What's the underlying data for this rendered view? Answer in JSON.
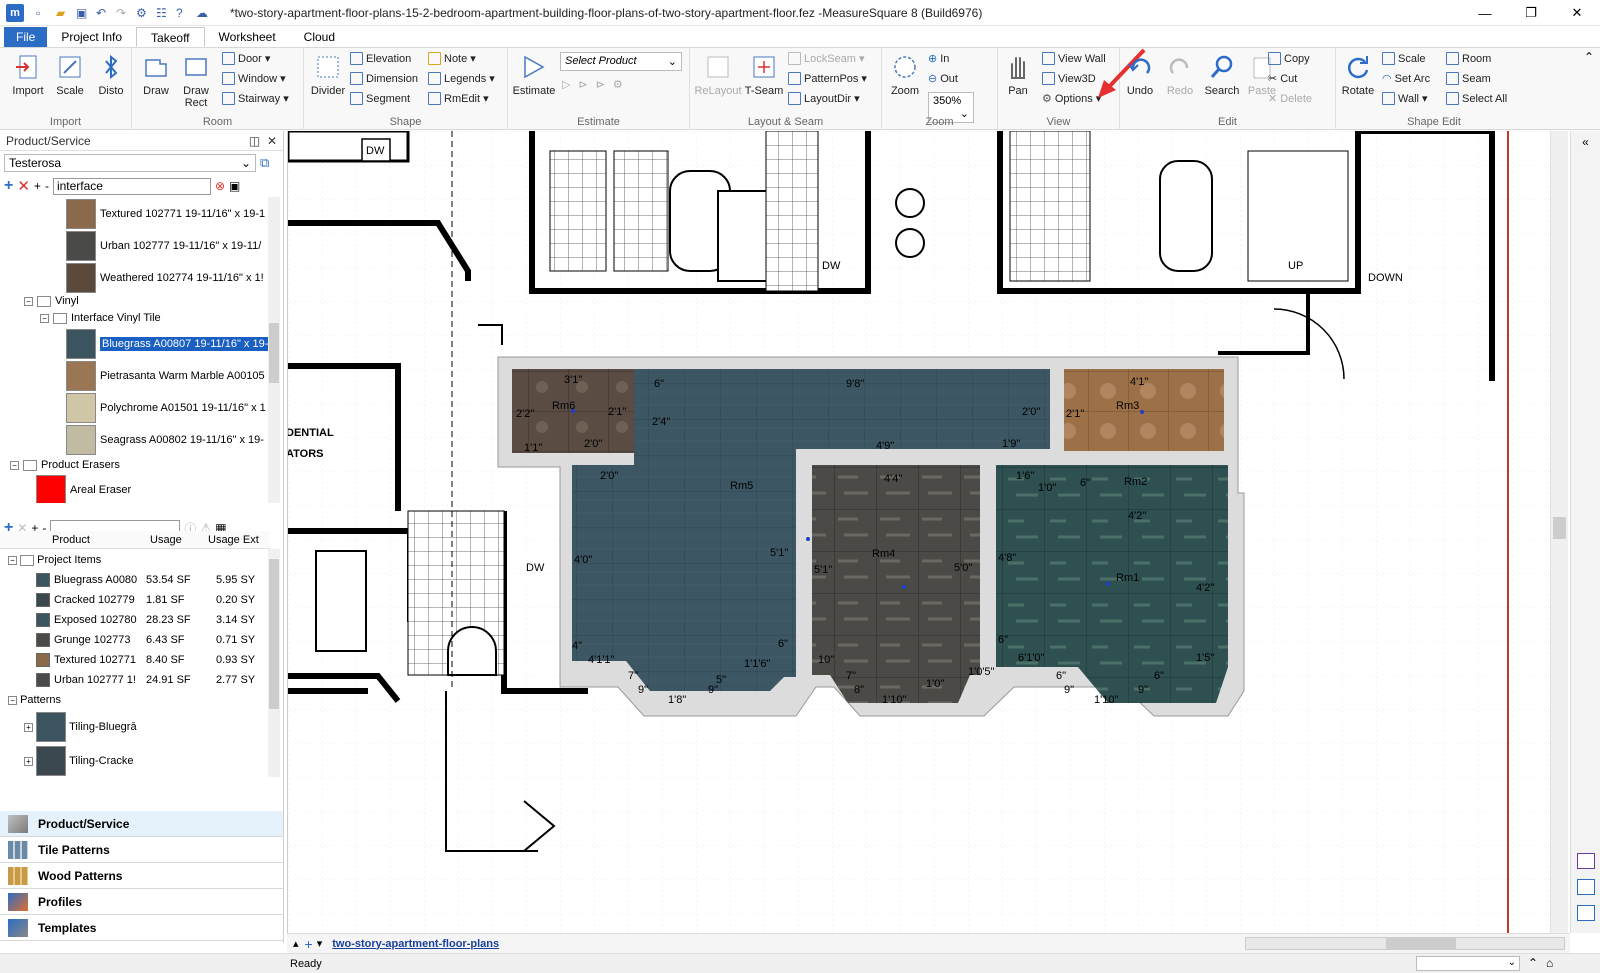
{
  "window": {
    "title": "*two-story-apartment-floor-plans-15-2-bedroom-apartment-building-floor-plans-of-two-story-apartment-floor.fez -MeasureSquare 8 (Build6976)",
    "app_icon": "m"
  },
  "tabs": [
    {
      "label": "File"
    },
    {
      "label": "Project Info"
    },
    {
      "label": "Takeoff"
    },
    {
      "label": "Worksheet"
    },
    {
      "label": "Cloud"
    }
  ],
  "ribbon": {
    "import": {
      "label": "Import",
      "items": [
        "Import",
        "Scale",
        "Disto"
      ]
    },
    "room": {
      "label": "Room",
      "draw": "Draw",
      "draw_rect": "Draw Rect",
      "door": "Door",
      "window": "Window",
      "stairway": "Stairway"
    },
    "shape": {
      "label": "Shape",
      "divider": "Divider",
      "elevation": "Elevation",
      "dimension": "Dimension",
      "segment": "Segment",
      "note": "Note",
      "legends": "Legends",
      "rmedit": "RmEdit"
    },
    "estimate": {
      "label": "Estimate",
      "estimate": "Estimate",
      "select_product": "Select Product"
    },
    "layout": {
      "label": "Layout & Seam",
      "relayout": "ReLayout",
      "tseam": "T-Seam",
      "lockseam": "LockSeam",
      "patternpos": "PatternPos",
      "layoutdir": "LayoutDir"
    },
    "zoom": {
      "label": "Zoom",
      "zoom": "Zoom",
      "in": "In",
      "out": "Out",
      "level": "350%"
    },
    "view": {
      "label": "View",
      "pan": "Pan",
      "view_wall": "View Wall",
      "view3d": "View3D",
      "options": "Options"
    },
    "edit": {
      "label": "Edit",
      "undo": "Undo",
      "redo": "Redo",
      "search": "Search",
      "paste": "Paste",
      "copy": "Copy",
      "cut": "Cut",
      "delete": "Delete"
    },
    "shape_edit": {
      "label": "Shape Edit",
      "rotate": "Rotate",
      "scale": "Scale",
      "set_arc": "Set Arc",
      "wall": "Wall",
      "room": "Room",
      "seam": "Seam",
      "select_all": "Select All"
    }
  },
  "left_panel": {
    "header": "Product/Service",
    "vendor": "Testerosa",
    "search_value": "interface",
    "tree": [
      {
        "label": "Textured 102771 19-11/16\" x 19-1",
        "color": "#8a6a4a"
      },
      {
        "label": "Urban 102777 19-11/16\" x 19-11/",
        "color": "#4a4a48"
      },
      {
        "label": "Weathered 102774 19-11/16\" x 1!",
        "color": "#5b4a3c"
      },
      {
        "label": "Vinyl"
      },
      {
        "label": "Interface Vinyl Tile"
      },
      {
        "label": "Bluegrass A00807 19-11/16\" x 19-",
        "color": "#3c5460"
      },
      {
        "label": "Pietrasanta Warm Marble A00105",
        "color": "#9a7654"
      },
      {
        "label": "Polychrome A01501 19-11/16\" x 1",
        "color": "#cfc6a8"
      },
      {
        "label": "Seagrass A00802 19-11/16\" x 19-",
        "color": "#c2bba4"
      },
      {
        "label": "Product Erasers"
      },
      {
        "label": "Areal Eraser",
        "color": "#ff0000"
      }
    ],
    "usage_headers": [
      "Product",
      "Usage",
      "Usage Ext"
    ],
    "project_items_label": "Project Items",
    "usage_rows": [
      {
        "name": "Bluegrass A0080",
        "usage": "53.54 SF",
        "ext": "5.95 SY",
        "color": "#3c5460"
      },
      {
        "name": "Cracked 102779",
        "usage": "1.81 SF",
        "ext": "0.20 SY",
        "color": "#3c4850"
      },
      {
        "name": "Exposed 102780",
        "usage": "28.23 SF",
        "ext": "3.14 SY",
        "color": "#3a5560"
      },
      {
        "name": "Grunge 102773",
        "usage": "6.43 SF",
        "ext": "0.71 SY",
        "color": "#4c4a46"
      },
      {
        "name": "Textured 102771",
        "usage": "8.40 SF",
        "ext": "0.93 SY",
        "color": "#8a6a4a"
      },
      {
        "name": "Urban 102777 1!",
        "usage": "24.91 SF",
        "ext": "2.77 SY",
        "color": "#4a4a48"
      }
    ],
    "patterns_label": "Patterns",
    "pattern_rows": [
      {
        "name": "Tiling-Bluegrā",
        "color": "#3c5460"
      },
      {
        "name": "Tiling-Cracke",
        "color": "#3c4850"
      }
    ]
  },
  "nav_buttons": [
    {
      "label": "Product/Service"
    },
    {
      "label": "Tile Patterns"
    },
    {
      "label": "Wood Patterns"
    },
    {
      "label": "Profiles"
    },
    {
      "label": "Templates"
    }
  ],
  "canvas": {
    "rooms": [
      {
        "name": "Rm6"
      },
      {
        "name": "Rm5"
      },
      {
        "name": "Rm3"
      },
      {
        "name": "Rm2"
      },
      {
        "name": "Rm4"
      },
      {
        "name": "Rm1"
      }
    ],
    "plan_labels": [
      "DW",
      "DW",
      "DENTIAL",
      "ATORS",
      "DW",
      "UP",
      "DOWN"
    ],
    "dims": [
      "3'1\"",
      "2'2\"",
      "2'1\"",
      "1'1\"",
      "2'0\"",
      "6\"",
      "9'8\"",
      "2'4\"",
      "2'0\"",
      "4'9\"",
      "1'9\"",
      "4'1\"",
      "2'1\"",
      "2'0\"",
      "1'6\"",
      "1'0\"",
      "4'4\"",
      "6\"",
      "4'2\"",
      "4'0\"",
      "5'1\"",
      "5'1\"",
      "5'0\"",
      "4'8\"",
      "4'2\"",
      "4\"",
      "4'1'1\"",
      "6\"",
      "1'1'6\"",
      "7\"",
      "9\"",
      "1'8\"",
      "9\"",
      "5\"",
      "10\"",
      "7\"",
      "8\"",
      "1'0\"",
      "1'10\"",
      "1'0'5\"",
      "6\"",
      "6'1'0\"",
      "1'5\"",
      "6\"",
      "9\"",
      "1'10\"",
      "9\"",
      "6\""
    ],
    "colors": {
      "bluegrass": "#3c5663",
      "stone": "#5a4c42",
      "marble": "#9c7148",
      "urban": "#4b4a46",
      "exposed": "#2f5050"
    }
  },
  "sheet_tab": "two-story-apartment-floor-plans",
  "status": "Ready"
}
